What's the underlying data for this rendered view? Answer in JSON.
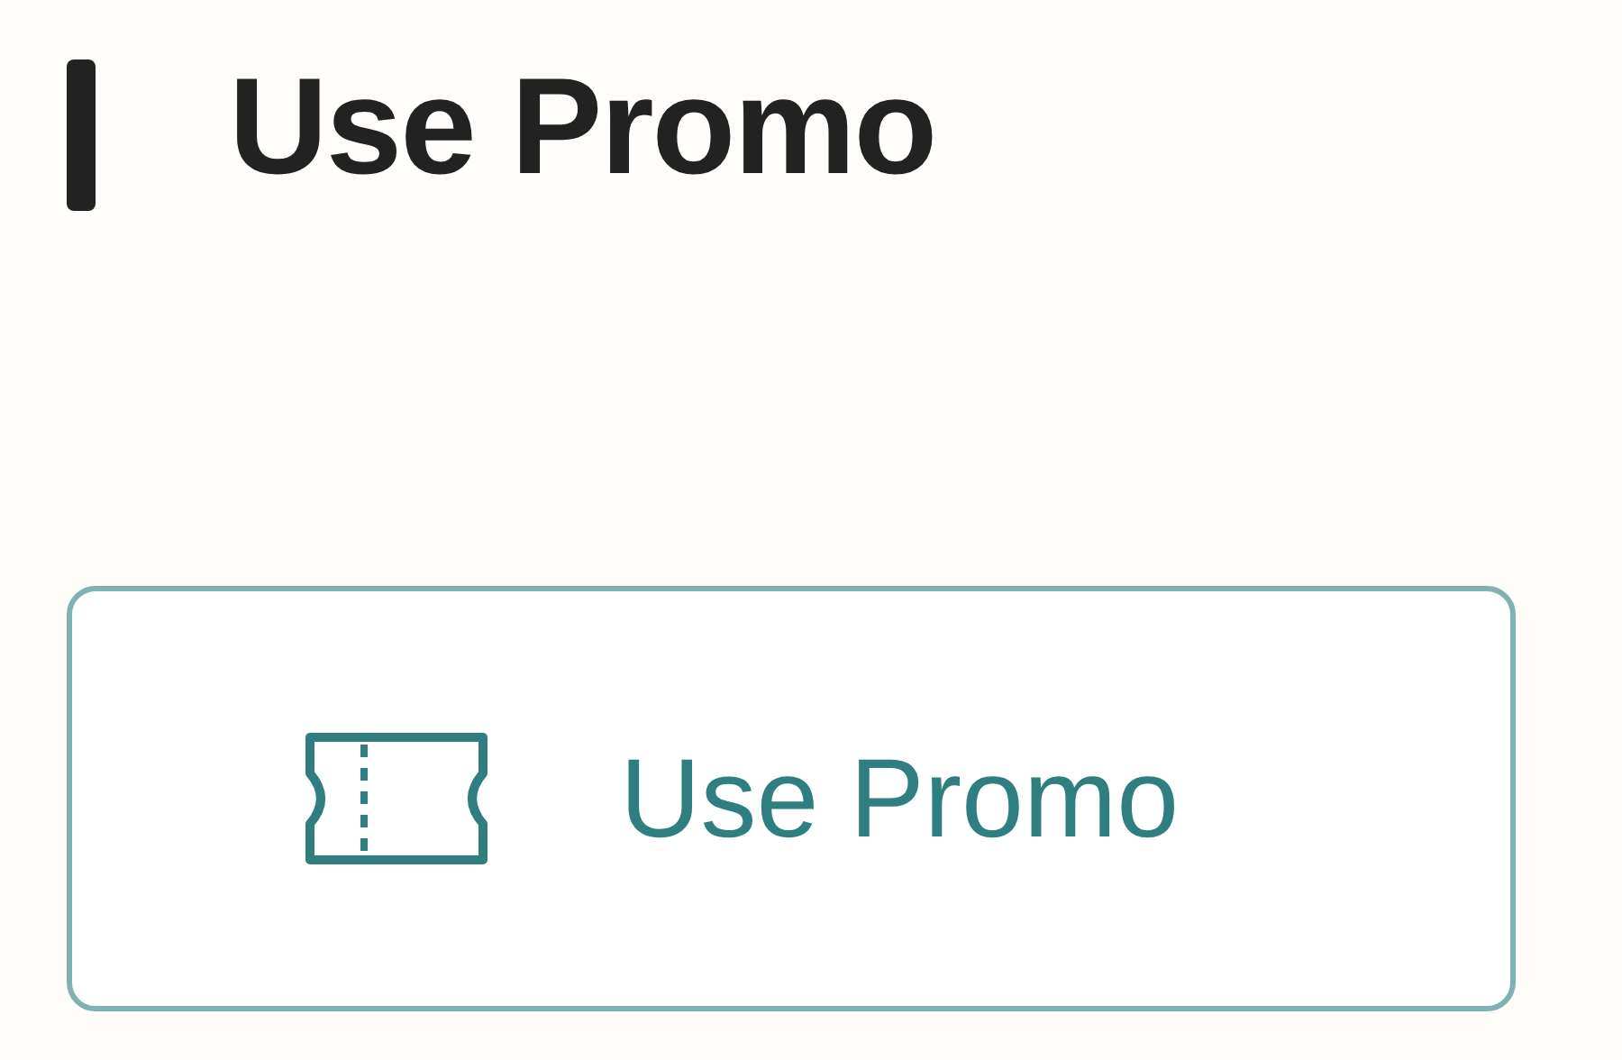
{
  "heading": {
    "title": "Use Promo"
  },
  "promo_button": {
    "label": "Use Promo"
  }
}
